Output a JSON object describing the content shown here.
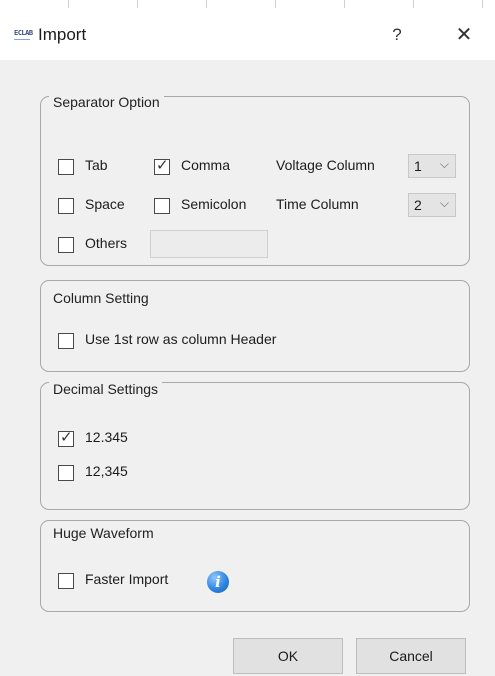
{
  "window": {
    "icon_text": "ECLAB",
    "title": "Import",
    "help_label": "?",
    "close_label": "✕"
  },
  "separator": {
    "title": "Separator Option",
    "tab": {
      "label": "Tab",
      "checked": false
    },
    "comma": {
      "label": "Comma",
      "checked": true
    },
    "space": {
      "label": "Space",
      "checked": false
    },
    "semicolon": {
      "label": "Semicolon",
      "checked": false
    },
    "others": {
      "label": "Others",
      "checked": false,
      "value": ""
    },
    "voltage_column": {
      "label": "Voltage Column",
      "value": "1"
    },
    "time_column": {
      "label": "Time Column",
      "value": "2"
    }
  },
  "column_setting": {
    "title": "Column Setting",
    "header_row": {
      "label": "Use 1st row as column Header",
      "checked": false
    }
  },
  "decimal": {
    "title": "Decimal Settings",
    "dot": {
      "label": "12.345",
      "checked": true
    },
    "comma": {
      "label": "12,345",
      "checked": false
    }
  },
  "huge_waveform": {
    "title": "Huge Waveform",
    "faster_import": {
      "label": "Faster Import",
      "checked": false
    },
    "info_icon": "info-icon"
  },
  "buttons": {
    "ok": "OK",
    "cancel": "Cancel"
  }
}
